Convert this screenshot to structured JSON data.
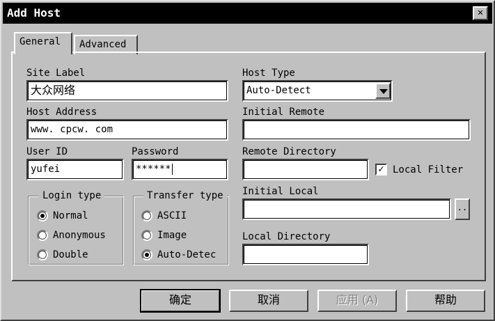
{
  "window": {
    "title": "Add Host",
    "close_glyph": "✕"
  },
  "tabs": [
    {
      "label": "General",
      "active": true
    },
    {
      "label": "Advanced",
      "active": false
    }
  ],
  "fields": {
    "site_label": {
      "label": "Site Label",
      "value": "大众网络"
    },
    "host_type": {
      "label": "Host Type",
      "value": "Auto-Detect"
    },
    "host_address": {
      "label": "Host Address",
      "value": "www. cpcw. com"
    },
    "initial_remote": {
      "label": "Initial Remote",
      "value": ""
    },
    "user_id": {
      "label": "User ID",
      "value": "yufei"
    },
    "password": {
      "label": "Password",
      "value": "******"
    },
    "remote_directory": {
      "label": "Remote Directory",
      "value": ""
    },
    "local_filter": {
      "label": "Local Filter",
      "checked": true,
      "glyph": "✓"
    },
    "initial_local": {
      "label": "Initial Local",
      "value": "",
      "browse_label": ".."
    },
    "local_directory": {
      "label": "Local Directory",
      "value": ""
    }
  },
  "login_type": {
    "legend": "Login type",
    "options": [
      {
        "label": "Normal",
        "checked": true
      },
      {
        "label": "Anonymous",
        "checked": false
      },
      {
        "label": "Double",
        "checked": false
      }
    ]
  },
  "transfer_type": {
    "legend": "Transfer type",
    "options": [
      {
        "label": "ASCII",
        "checked": false
      },
      {
        "label": "Image",
        "checked": false
      },
      {
        "label": "Auto-Detec",
        "checked": true
      }
    ]
  },
  "buttons": {
    "ok": "确定",
    "cancel": "取消",
    "apply": "应用 (A)",
    "help": "帮助"
  }
}
